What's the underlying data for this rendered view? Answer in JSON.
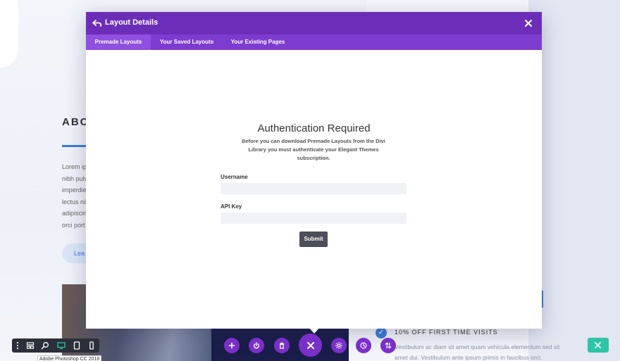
{
  "background": {
    "heading": "ABC",
    "paragraph_lines": [
      "Lorem ip",
      "nibh pulv",
      "imperdie",
      "lectus nil",
      "adipiscin",
      "orci port"
    ],
    "button_label": "Lea",
    "offer_title": "10% OFF FIRST TIME VISITS",
    "offer_text": "Vestibulum ac diam sit amet quam vehicula elementum sed sit amet dui. Vestibulum ante ipsum primis in faucibus orci.",
    "ps_label": "Adobe Photoshop CC 2018"
  },
  "modal": {
    "title": "Layout Details",
    "tabs": [
      {
        "label": "Premade Layouts",
        "active": true
      },
      {
        "label": "Your Saved Layouts",
        "active": false
      },
      {
        "label": "Your Existing Pages",
        "active": false
      }
    ],
    "auth_title": "Authentication Required",
    "auth_description": "Before you can download Premade Layouts from the Divi Library you must authenticate your Elegant Themes subscription.",
    "username_label": "Username",
    "username_value": "",
    "api_key_label": "API Key",
    "api_key_value": "",
    "submit_label": "Submit"
  },
  "bottom_toolbar": {
    "left_icons": [
      "more-vertical-icon",
      "wireframe-icon",
      "zoom-icon",
      "desktop-icon",
      "tablet-icon",
      "phone-icon"
    ],
    "center_icons": [
      "add-icon",
      "power-icon",
      "trash-icon",
      "close-icon",
      "settings-icon",
      "history-icon",
      "sort-icon"
    ],
    "right_icon": "close-icon"
  },
  "colors": {
    "header_purple": "#6c2eb9",
    "tab_bar_purple": "#7e3bd0",
    "active_tab": "#8f4fe0",
    "fab_purple": "#7a2fc8",
    "submit_gray": "#4a4f59",
    "teal": "#2ec4a6",
    "accent_blue": "#3b7dd8"
  }
}
